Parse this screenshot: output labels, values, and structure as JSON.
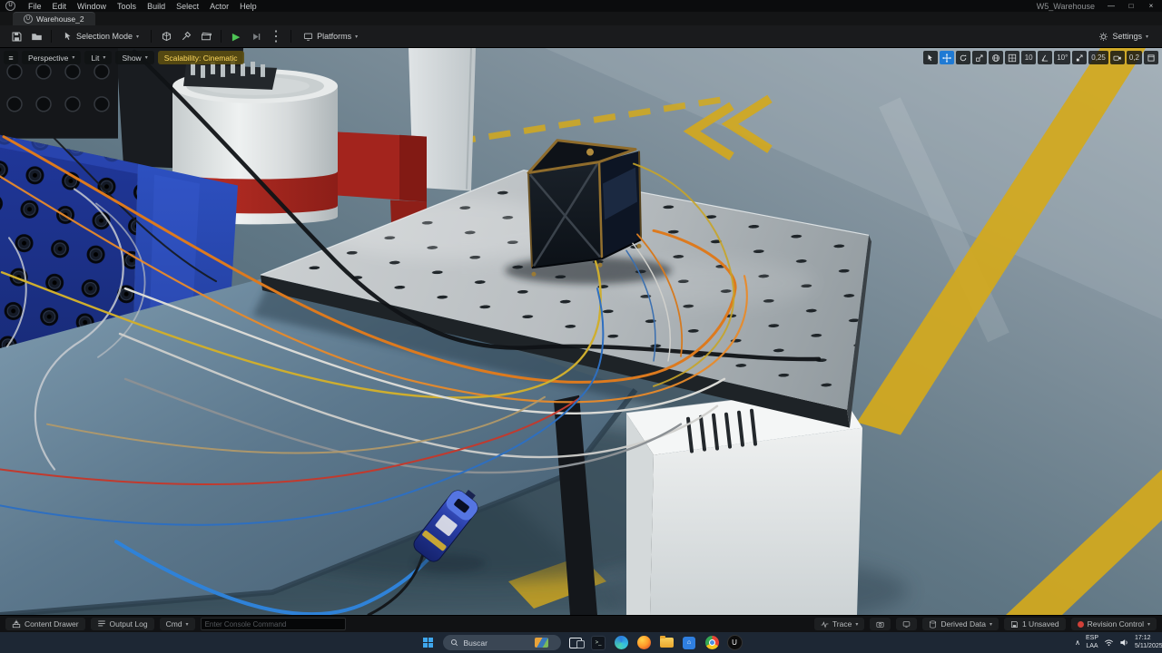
{
  "window": {
    "project": "W5_Warehouse",
    "menu": [
      "File",
      "Edit",
      "Window",
      "Tools",
      "Build",
      "Select",
      "Actor",
      "Help"
    ],
    "controls": {
      "minimize": "—",
      "maximize": "□",
      "close": "×"
    }
  },
  "tabs": {
    "active": "Warehouse_2"
  },
  "toolbar": {
    "selection_mode": "Selection Mode",
    "platforms": "Platforms",
    "settings": "Settings"
  },
  "viewport": {
    "camera_mode": "Perspective",
    "view_mode": "Lit",
    "show_menu": "Show",
    "scalability": "Scalability: Cinematic",
    "grid_snap_value": "10",
    "rotation_snap_value": "10°",
    "scale_snap_value": "0,25",
    "camera_speed_value": "0,2"
  },
  "statusbar": {
    "content_drawer": "Content Drawer",
    "output_log": "Output Log",
    "cmd": "Cmd",
    "console_placeholder": "Enter Console Command",
    "trace": "Trace",
    "derived_data": "Derived Data",
    "unsaved": "1 Unsaved",
    "revision_control": "Revision Control"
  },
  "taskbar": {
    "search_placeholder": "Buscar",
    "language_line1": "ESP",
    "language_line2": "LAA",
    "time": "17:12",
    "date": "5/11/2025",
    "app_icons": [
      "start",
      "search",
      "task-view",
      "terminal",
      "edge",
      "firefox",
      "file-explorer",
      "store",
      "chrome",
      "unreal-engine"
    ]
  },
  "scene": {
    "description": "Warehouse level: CubeSat test device on perforated optical table, cable harness from blue equipment rack, hazard-striped floor",
    "palette": {
      "floor_dark": "#3d5260",
      "floor_light": "#a2aeb6",
      "hazard_yellow": "#d4a91c",
      "rack_blue": "#20379a",
      "plate_gray": "#c9cdcf",
      "cube_dark": "#10141c",
      "cube_frame_gold": "#8f6c2c",
      "tester_blue": "#3a55c8",
      "cable_orange": "#dd7a1e",
      "cable_yellow": "#cfae2e",
      "cable_blue": "#2f82d8",
      "cable_red": "#c13a2e",
      "cable_white": "#dadad6"
    }
  }
}
